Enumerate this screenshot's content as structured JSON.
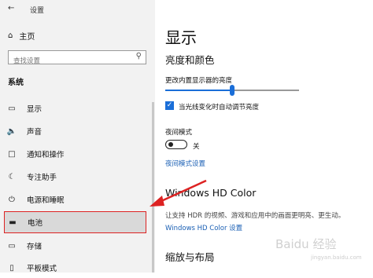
{
  "window": {
    "title": "设置"
  },
  "sidebar": {
    "home_label": "主页",
    "search_placeholder": "查找设置",
    "section_title": "系统",
    "items": [
      {
        "label": "显示",
        "icon": "monitor-icon"
      },
      {
        "label": "声音",
        "icon": "speaker-icon"
      },
      {
        "label": "通知和操作",
        "icon": "notification-icon"
      },
      {
        "label": "专注助手",
        "icon": "moon-icon"
      },
      {
        "label": "电源和睡眠",
        "icon": "power-icon"
      },
      {
        "label": "电池",
        "icon": "battery-icon",
        "selected": true
      },
      {
        "label": "存储",
        "icon": "storage-icon"
      },
      {
        "label": "平板模式",
        "icon": "tablet-icon"
      }
    ]
  },
  "main": {
    "page_title": "显示",
    "brightness_heading": "亮度和颜色",
    "brightness_label": "更改内置显示器的亮度",
    "brightness_level": 0.5,
    "auto_brightness_label": "当光线变化时自动调节亮度",
    "auto_brightness_checked": true,
    "night_mode_label": "夜间模式",
    "night_mode_state": "关",
    "night_mode_link": "夜间模式设置",
    "hd_heading": "Windows HD Color",
    "hd_desc": "让支持 HDR 的视频、游戏和应用中的画面更明亮、更生动。",
    "hd_link": "Windows HD Color 设置",
    "zoom_heading": "缩放与布局"
  },
  "watermark": {
    "text": "Baidu 经验",
    "sub": "jingyan.baidu.com"
  },
  "colors": {
    "accent": "#1a6ed8",
    "annotation_red": "#dd2222"
  }
}
